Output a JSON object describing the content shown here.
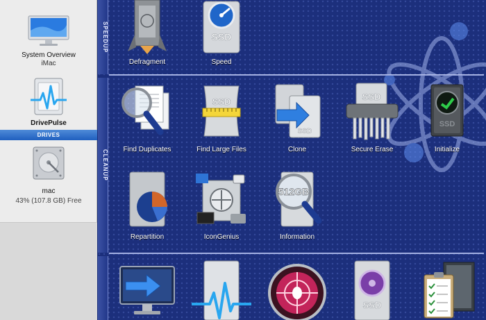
{
  "sidebar": {
    "system": {
      "label": "System Overview",
      "sub": "iMac"
    },
    "drivepulse": {
      "label": "DrivePulse"
    },
    "drives_header": "DRIVES",
    "drive": {
      "label": "mac",
      "sub": "43% (107.8 GB) Free"
    }
  },
  "sections": {
    "speedup": "SPEEDUP",
    "cleanup": "CLEANUP"
  },
  "tools": {
    "defragment": "Defragment",
    "speed": "Speed",
    "find_duplicates": "Find Duplicates",
    "find_large_files": "Find Large Files",
    "clone": "Clone",
    "secure_erase": "Secure Erase",
    "initialize": "Initialize",
    "repartition": "Repartition",
    "icongenius": "IconGenius",
    "information": "Information",
    "disk_badge": "512GB",
    "ssd_badge": "SSD"
  },
  "colors": {
    "background": "#1c2f7c",
    "sidebar": "#ececec",
    "drives_header": "#2a6bd0",
    "label_text": "#ffffff"
  }
}
